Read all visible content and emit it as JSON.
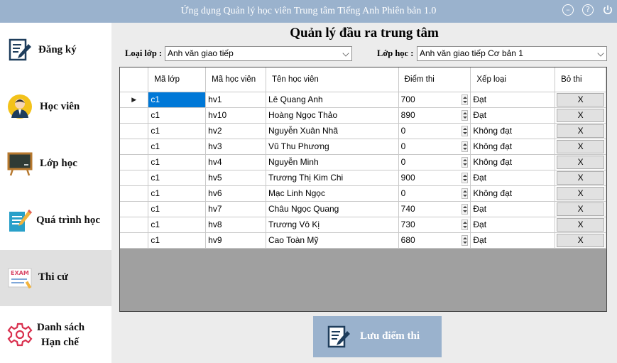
{
  "app": {
    "title": "Ứng dụng Quản lý học viên Trung tâm Tiếng Anh Phiên bản 1.0",
    "icons": [
      "minimize-icon",
      "help-icon",
      "power-icon"
    ]
  },
  "sidebar": {
    "items": [
      {
        "label": "Đăng ký",
        "icon": "register-icon"
      },
      {
        "label": "Học viên",
        "icon": "student-icon"
      },
      {
        "label": "Lớp học",
        "icon": "classroom-icon"
      },
      {
        "label": "Quá trình học",
        "icon": "progress-icon"
      },
      {
        "label": "Thi cử",
        "icon": "exam-icon",
        "icon_text": "EXAM",
        "active": true
      },
      {
        "label_line1": "Danh sách",
        "label_line2": "Hạn chế",
        "icon": "gear-icon"
      }
    ]
  },
  "main": {
    "title": "Quản lý đầu ra trung tâm",
    "class_type_label": "Loại lớp :",
    "class_type_value": "Anh văn giao tiếp",
    "class_label": "Lớp học :",
    "class_value": "Anh văn giao tiếp Cơ bản 1",
    "save_label": "Lưu điểm thi"
  },
  "grid": {
    "columns": [
      "Mã lớp",
      "Mã học viên",
      "Tên học viên",
      "Điểm thi",
      "Xếp loại",
      "Bỏ thi"
    ],
    "remove_label": "X",
    "rows": [
      {
        "class_id": "c1",
        "student_id": "hv1",
        "name": "Lê Quang Anh",
        "score": "700",
        "grade": "Đạt"
      },
      {
        "class_id": "c1",
        "student_id": "hv10",
        "name": "Hoàng Ngọc Thảo",
        "score": "890",
        "grade": "Đạt"
      },
      {
        "class_id": "c1",
        "student_id": "hv2",
        "name": "Nguyễn Xuân Nhã",
        "score": "0",
        "grade": "Không đạt"
      },
      {
        "class_id": "c1",
        "student_id": "hv3",
        "name": "Vũ Thu Phương",
        "score": "0",
        "grade": "Không đạt"
      },
      {
        "class_id": "c1",
        "student_id": "hv4",
        "name": "Nguyễn Minh",
        "score": "0",
        "grade": "Không đạt"
      },
      {
        "class_id": "c1",
        "student_id": "hv5",
        "name": "Trương Thị Kim Chi",
        "score": "900",
        "grade": "Đạt"
      },
      {
        "class_id": "c1",
        "student_id": "hv6",
        "name": "Mạc Linh Ngọc",
        "score": "0",
        "grade": "Không đạt"
      },
      {
        "class_id": "c1",
        "student_id": "hv7",
        "name": "Châu Ngọc Quang",
        "score": "740",
        "grade": "Đạt"
      },
      {
        "class_id": "c1",
        "student_id": "hv8",
        "name": "Trương Vô Kị",
        "score": "730",
        "grade": "Đạt"
      },
      {
        "class_id": "c1",
        "student_id": "hv9",
        "name": "Cao Toàn Mỹ",
        "score": "680",
        "grade": "Đạt"
      }
    ]
  },
  "colors": {
    "accent": "#9ab2cd",
    "selection": "#0078d7"
  }
}
